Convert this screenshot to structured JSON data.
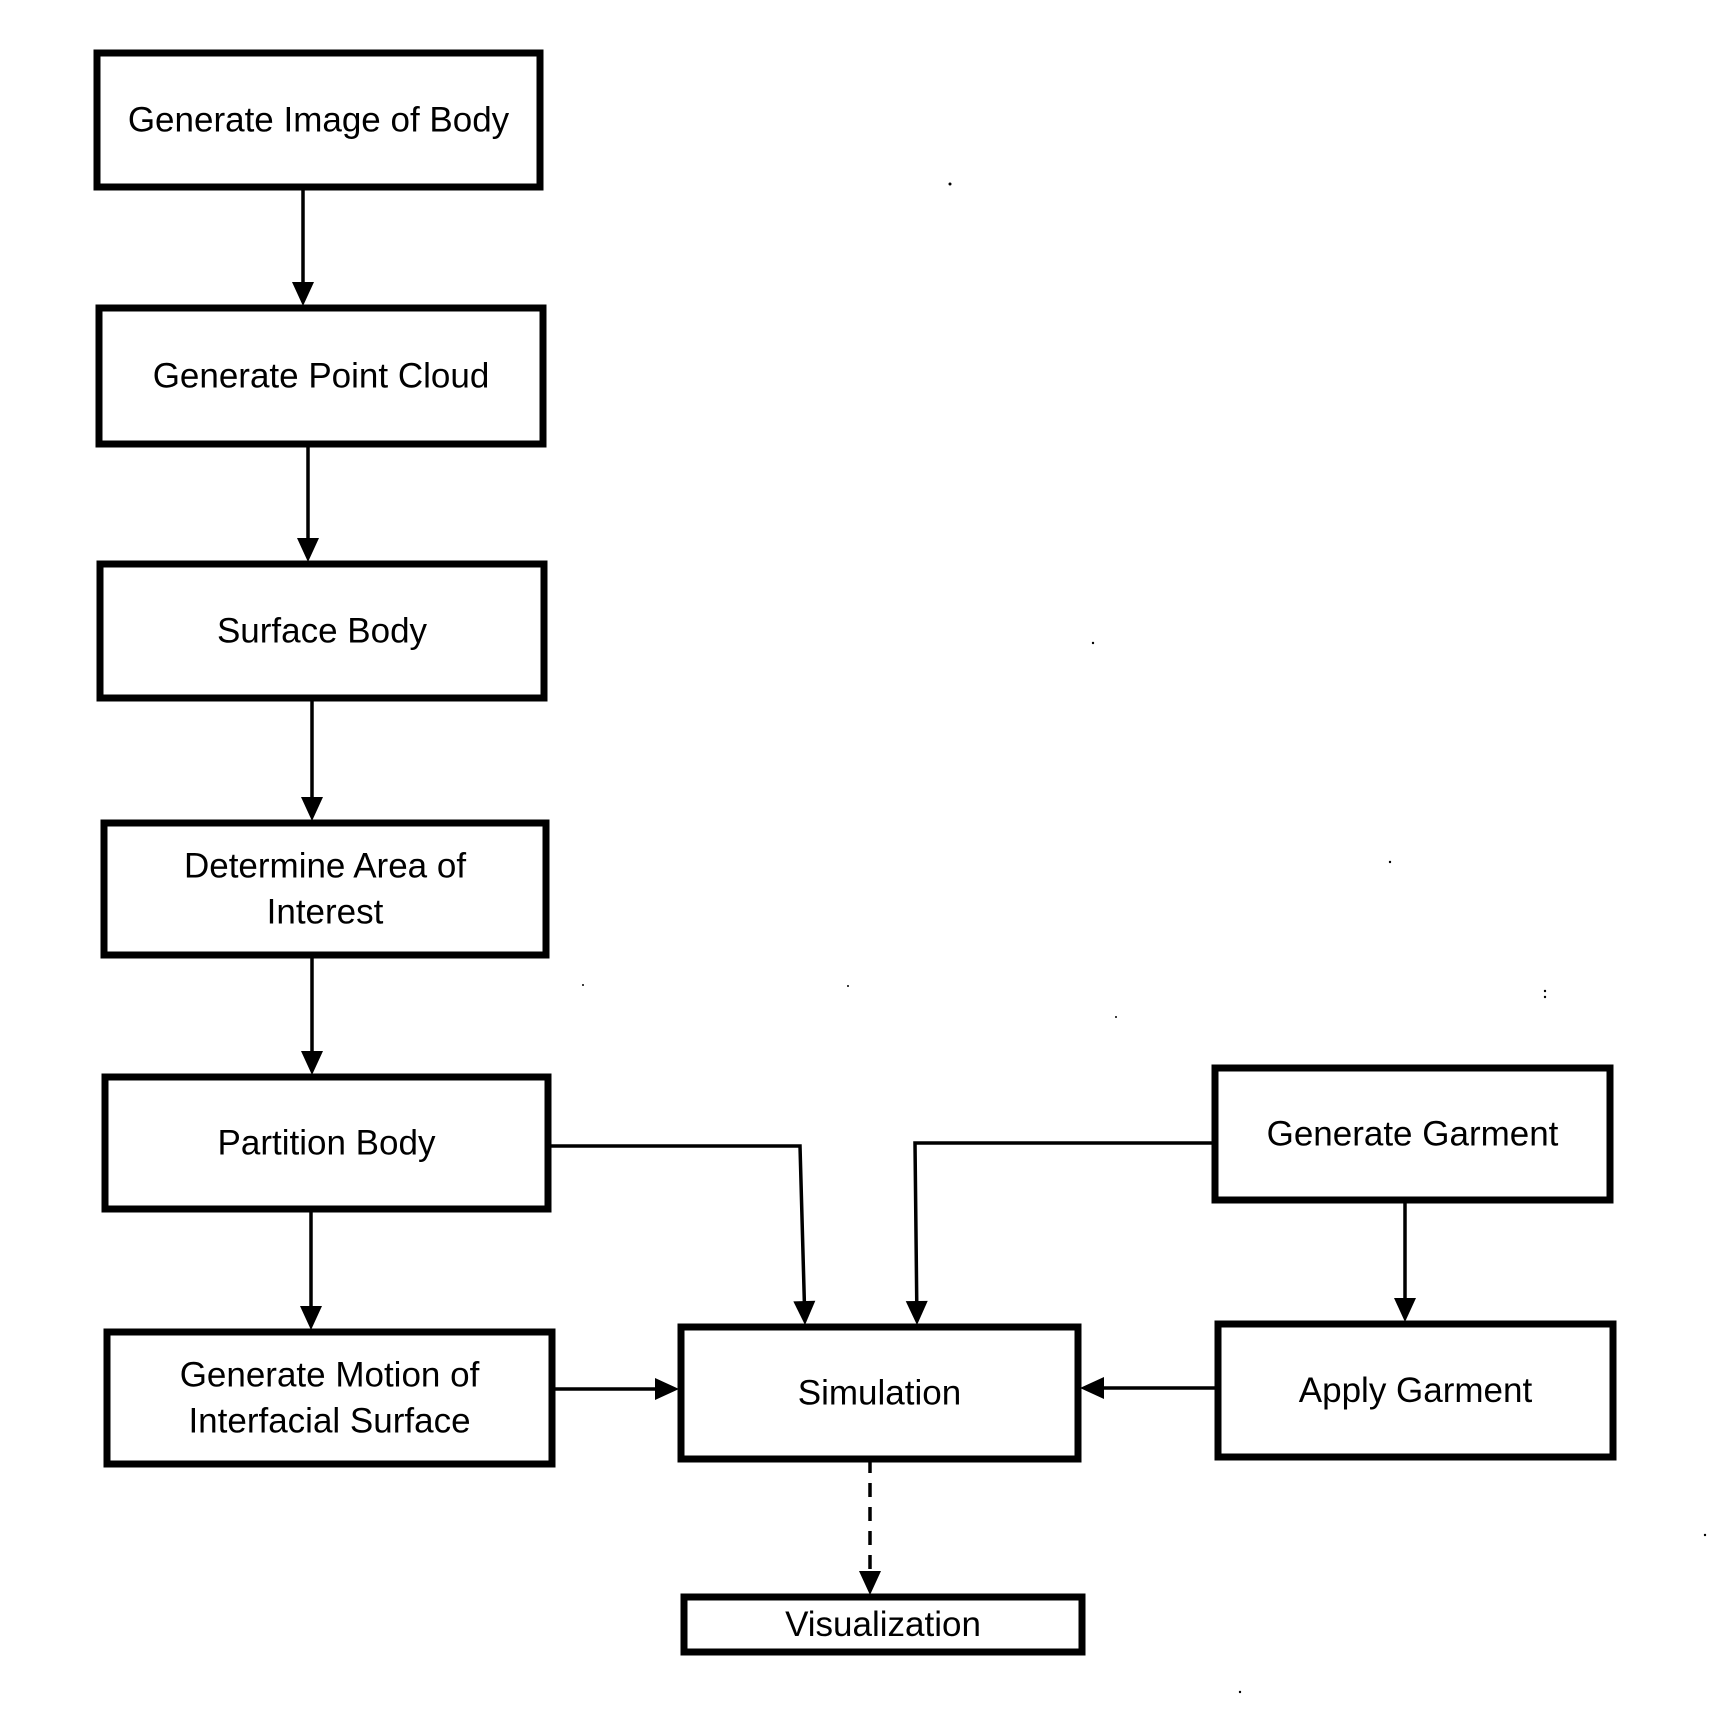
{
  "diagram": {
    "type": "flowchart",
    "colors": {
      "stroke": "#000000",
      "background": "#ffffff",
      "text": "#000000"
    },
    "nodes": [
      {
        "id": "generate-image",
        "lines": [
          "Generate Image of Body"
        ]
      },
      {
        "id": "generate-point-cloud",
        "lines": [
          "Generate Point Cloud"
        ]
      },
      {
        "id": "surface-body",
        "lines": [
          "Surface Body"
        ]
      },
      {
        "id": "determine-area",
        "lines": [
          "Determine Area of",
          "Interest"
        ]
      },
      {
        "id": "partition-body",
        "lines": [
          "Partition Body"
        ]
      },
      {
        "id": "generate-motion",
        "lines": [
          "Generate Motion of",
          "Interfacial Surface"
        ]
      },
      {
        "id": "simulation",
        "lines": [
          "Simulation"
        ]
      },
      {
        "id": "generate-garment",
        "lines": [
          "Generate Garment"
        ]
      },
      {
        "id": "apply-garment",
        "lines": [
          "Apply Garment"
        ]
      },
      {
        "id": "visualization",
        "lines": [
          "Visualization"
        ]
      }
    ],
    "edges": [
      {
        "from": "generate-image",
        "to": "generate-point-cloud",
        "style": "solid"
      },
      {
        "from": "generate-point-cloud",
        "to": "surface-body",
        "style": "solid"
      },
      {
        "from": "surface-body",
        "to": "determine-area",
        "style": "solid"
      },
      {
        "from": "determine-area",
        "to": "partition-body",
        "style": "solid"
      },
      {
        "from": "partition-body",
        "to": "generate-motion",
        "style": "solid"
      },
      {
        "from": "partition-body",
        "to": "simulation",
        "style": "solid"
      },
      {
        "from": "generate-motion",
        "to": "simulation",
        "style": "solid"
      },
      {
        "from": "generate-garment",
        "to": "simulation",
        "style": "solid"
      },
      {
        "from": "generate-garment",
        "to": "apply-garment",
        "style": "solid"
      },
      {
        "from": "apply-garment",
        "to": "simulation",
        "style": "solid"
      },
      {
        "from": "simulation",
        "to": "visualization",
        "style": "dashed"
      }
    ]
  }
}
